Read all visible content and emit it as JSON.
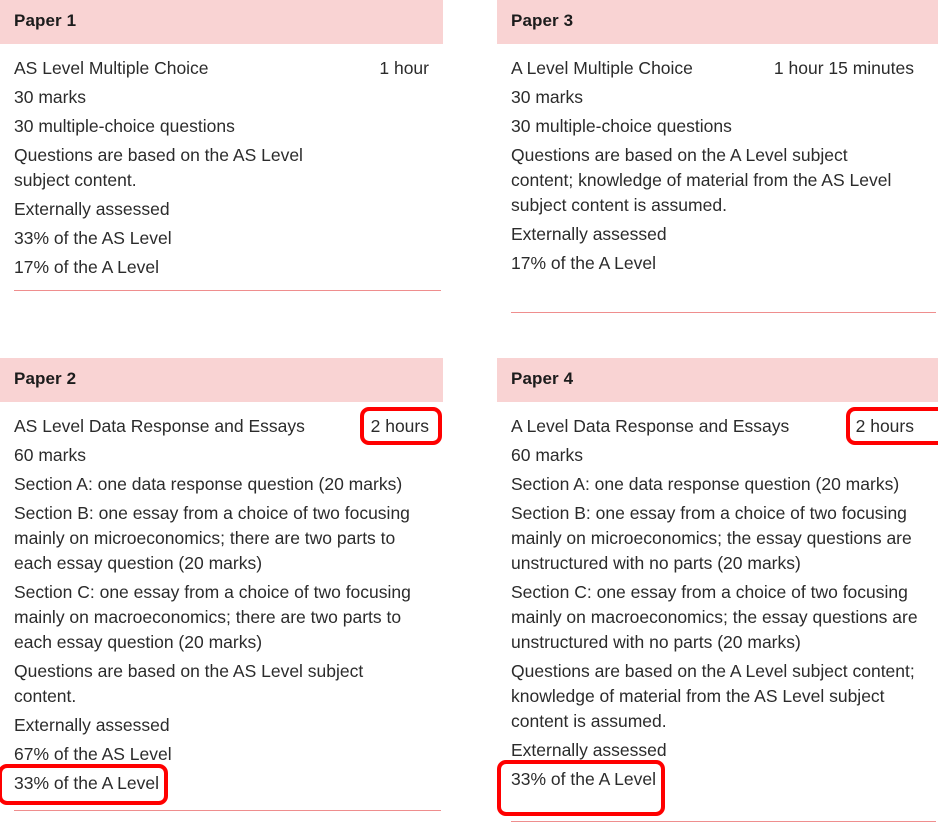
{
  "accent": {
    "header_bg": "#f9d3d3",
    "divider": "#ef8e8e",
    "annotation": "#ff0000",
    "text": "#2b2b2b"
  },
  "papers": [
    {
      "id": "paper-1",
      "title": "Paper 1",
      "name": "AS Level Multiple Choice",
      "duration": "1 hour",
      "duration_highlighted": false,
      "lines": [
        "30 marks",
        "30 multiple-choice questions",
        "Questions are based on the AS Level subject content.",
        "Externally assessed",
        "33% of the AS Level",
        "17% of the A Level"
      ],
      "highlighted_line_index": null
    },
    {
      "id": "paper-3",
      "title": "Paper 3",
      "name": "A Level Multiple Choice",
      "duration": "1 hour 15 minutes",
      "duration_highlighted": false,
      "lines": [
        "30 marks",
        "30 multiple-choice questions",
        "Questions are based on the A Level subject content; knowledge of material from the AS Level subject content is assumed.",
        "Externally assessed",
        "17% of the A Level"
      ],
      "highlighted_line_index": null
    },
    {
      "id": "paper-2",
      "title": "Paper 2",
      "name": "AS Level Data Response and Essays",
      "duration": "2 hours",
      "duration_highlighted": true,
      "lines": [
        "60 marks",
        "Section A: one data response question (20 marks)",
        "Section B: one essay from a choice of two focusing mainly on microeconomics; there are two parts to each essay question (20 marks)",
        "Section C: one essay from a choice of two focusing mainly on macroeconomics; there are two parts to each essay question (20 marks)",
        "Questions are based on the AS Level subject content.",
        "Externally assessed",
        "67% of the AS Level",
        "33% of the A Level"
      ],
      "highlighted_line_index": 7
    },
    {
      "id": "paper-4",
      "title": "Paper 4",
      "name": "A Level Data Response and Essays",
      "duration": "2 hours",
      "duration_highlighted": true,
      "lines": [
        "60 marks",
        "Section A: one data response question (20 marks)",
        "Section B: one essay from a choice of two focusing mainly on microeconomics; the essay questions are unstructured with no parts (20 marks)",
        "Section C: one essay from a choice of two focusing mainly on macroeconomics; the essay questions are unstructured with no parts (20 marks)",
        "Questions are based on the A Level subject content; knowledge of material from the AS Level subject content is assumed.",
        "Externally assessed",
        "33% of the A Level"
      ],
      "highlighted_line_index": 6
    }
  ]
}
